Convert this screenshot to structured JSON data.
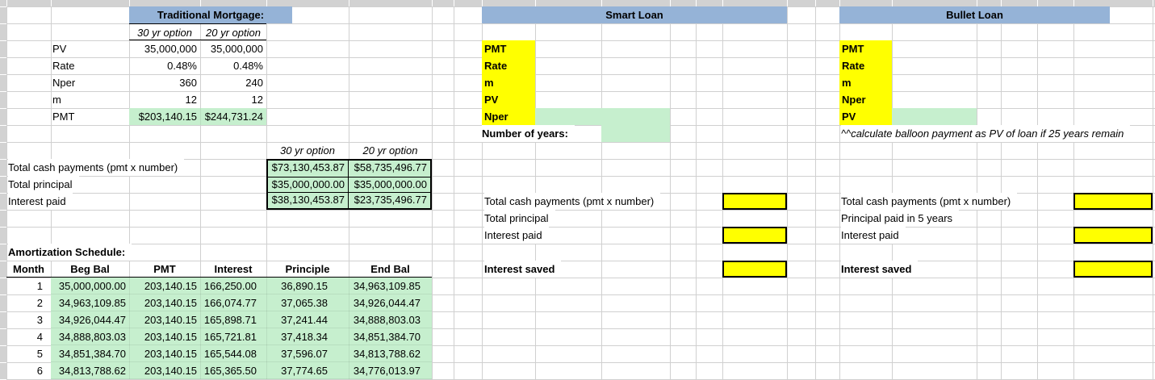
{
  "sheet": {
    "traditional": {
      "title": "Traditional Mortgage:",
      "options": [
        "30 yr option",
        "20 yr option"
      ],
      "params": [
        {
          "label": "PV",
          "v30": "35,000,000",
          "v20": "35,000,000"
        },
        {
          "label": "Rate",
          "v30": "0.48%",
          "v20": "0.48%"
        },
        {
          "label": "Nper",
          "v30": "360",
          "v20": "240"
        },
        {
          "label": "m",
          "v30": "12",
          "v20": "12"
        },
        {
          "label": "PMT",
          "v30": "$203,140.15",
          "v20": "$244,731.24"
        }
      ],
      "totals_options": [
        "30 yr option",
        "20 yr option"
      ],
      "totals": [
        {
          "label": "Total cash payments (pmt x number)",
          "v30": "$73,130,453.87",
          "v20": "$58,735,496.77"
        },
        {
          "label": "Total principal",
          "v30": "$35,000,000.00",
          "v20": "$35,000,000.00"
        },
        {
          "label": "Interest paid",
          "v30": "$38,130,453.87",
          "v20": "$23,735,496.77"
        }
      ]
    },
    "smart": {
      "title": "Smart Loan",
      "params": [
        "PMT",
        "Rate",
        "m",
        "PV",
        "Nper"
      ],
      "years_label": "Number of years:",
      "rows": [
        "Total cash payments (pmt x number)",
        "Total principal",
        "Interest paid",
        "Interest saved"
      ]
    },
    "bullet": {
      "title": "Bullet Loan",
      "params": [
        "PMT",
        "Rate",
        "m",
        "Nper",
        "PV"
      ],
      "note": "^^calculate balloon payment as PV of loan if 25 years remain",
      "rows": [
        "Total cash payments (pmt x number)",
        "Principal paid in 5 years",
        "Interest paid",
        "Interest saved"
      ]
    },
    "amortization": {
      "title": "Amortization Schedule:",
      "headers": [
        "Month",
        "Beg Bal",
        "PMT",
        "Interest",
        "Principle",
        "End Bal"
      ],
      "rows": [
        [
          "1",
          "35,000,000.00",
          "203,140.15",
          "166,250.00",
          "36,890.15",
          "34,963,109.85"
        ],
        [
          "2",
          "34,963,109.85",
          "203,140.15",
          "166,074.77",
          "37,065.38",
          "34,926,044.47"
        ],
        [
          "3",
          "34,926,044.47",
          "203,140.15",
          "165,898.71",
          "37,241.44",
          "34,888,803.03"
        ],
        [
          "4",
          "34,888,803.03",
          "203,140.15",
          "165,721.81",
          "37,418.34",
          "34,851,384.70"
        ],
        [
          "5",
          "34,851,384.70",
          "203,140.15",
          "165,544.08",
          "37,596.07",
          "34,813,788.62"
        ],
        [
          "6",
          "34,813,788.62",
          "203,140.15",
          "165,365.50",
          "37,774.65",
          "34,776,013.97"
        ]
      ]
    },
    "colors": {
      "header_blue": "#95B3D7",
      "highlight_yellow": "#FFFF00",
      "highlight_green": "#C6EFCE"
    }
  }
}
